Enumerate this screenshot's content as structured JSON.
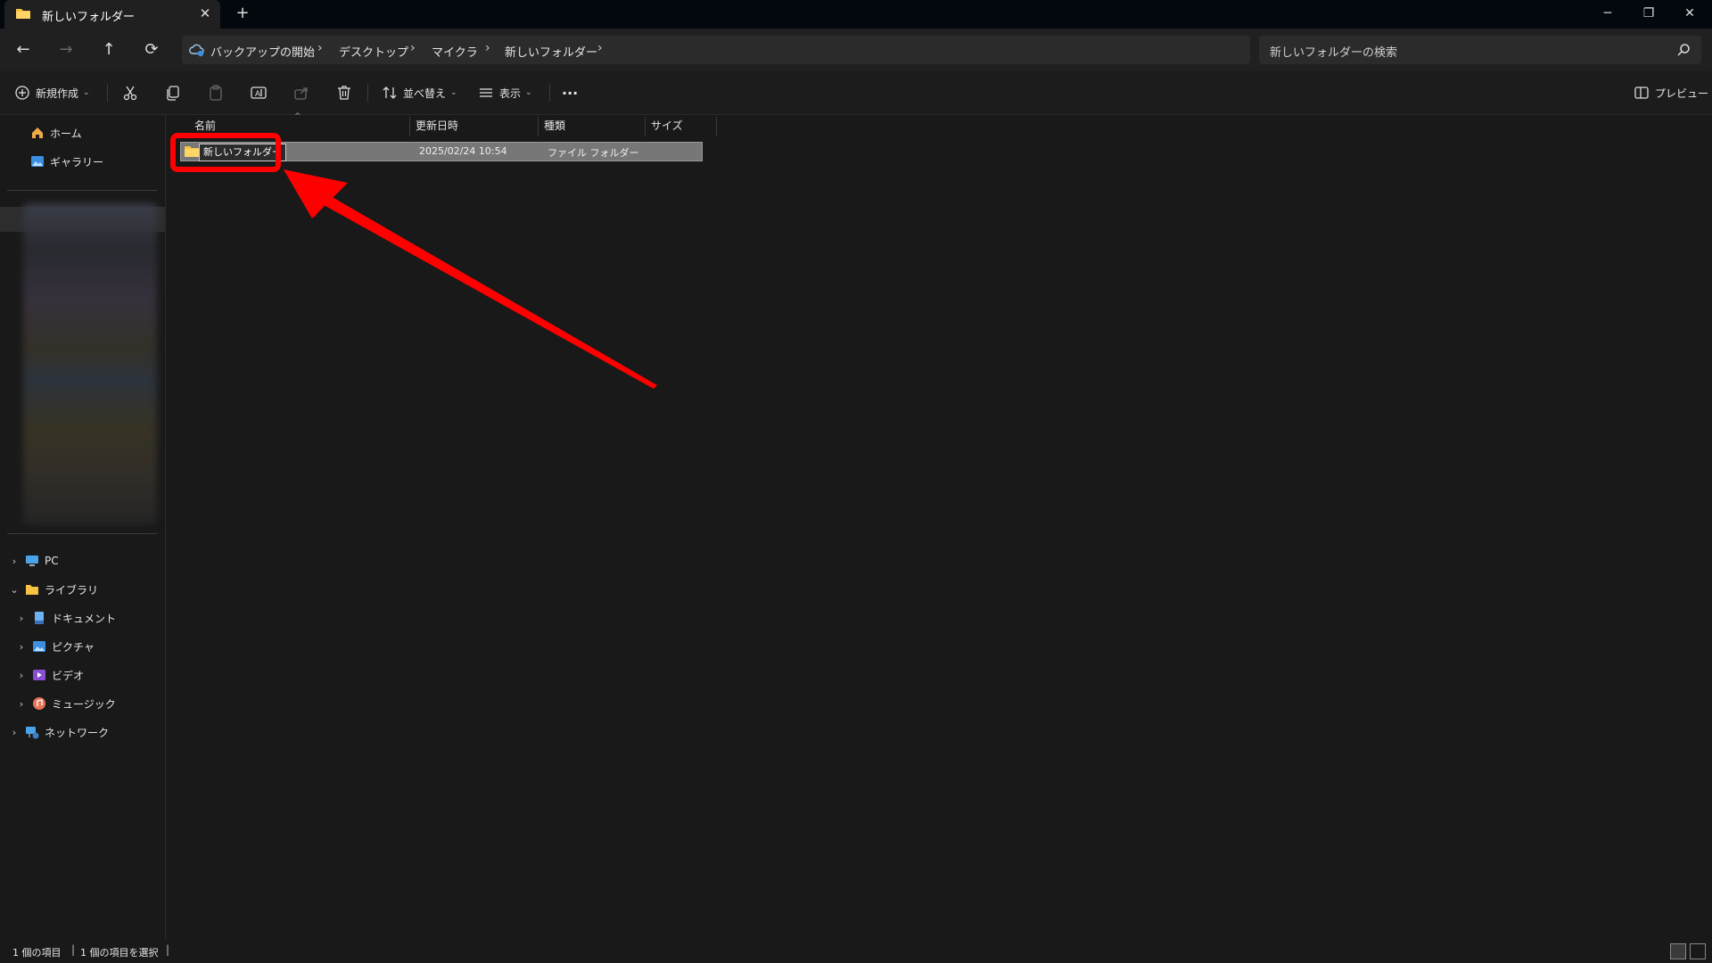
{
  "tab": {
    "title": "新しいフォルダー",
    "close": "✕",
    "new": "+"
  },
  "window": {
    "minimize": "─",
    "restore": "❐",
    "close": "✕"
  },
  "nav": {
    "back": "←",
    "forward": "→",
    "up": "↑",
    "refresh": "⟳"
  },
  "breadcrumb": {
    "items": [
      "バックアップの開始",
      "デスクトップ",
      "マイクラ",
      "新しいフォルダー"
    ],
    "sep": "›"
  },
  "search": {
    "placeholder": "新しいフォルダーの検索"
  },
  "command_bar": {
    "new_label": "新規作成",
    "sort_label": "並べ替え",
    "view_label": "表示",
    "more": "···",
    "preview_label": "プレビュー"
  },
  "sidebar": {
    "quick": [
      {
        "label": "ホーム",
        "icon": "home-icon"
      },
      {
        "label": "ギャラリー",
        "icon": "gallery-icon"
      }
    ],
    "tree": [
      {
        "label": "PC",
        "icon": "pc-icon",
        "expander": "›"
      },
      {
        "label": "ライブラリ",
        "icon": "folder-icon",
        "expander": "⌄"
      },
      {
        "label": "ドキュメント",
        "icon": "document-icon",
        "expander": "›"
      },
      {
        "label": "ピクチャ",
        "icon": "picture-icon",
        "expander": "›"
      },
      {
        "label": "ビデオ",
        "icon": "video-icon",
        "expander": "›"
      },
      {
        "label": "ミュージック",
        "icon": "music-icon",
        "expander": "›"
      },
      {
        "label": "ネットワーク",
        "icon": "network-icon",
        "expander": "›"
      }
    ]
  },
  "columns": {
    "name": "名前",
    "modified": "更新日時",
    "type": "種類",
    "size": "サイズ"
  },
  "files": [
    {
      "name": "新しいフォルダー",
      "modified": "2025/02/24 10:54",
      "type": "ファイル フォルダー",
      "size": ""
    }
  ],
  "status": {
    "count": "1 個の項目",
    "selected": "1 個の項目を選択",
    "sep": "|"
  },
  "colors": {
    "annotation": "#ff0000",
    "folder": "#f5c243",
    "background": "#191919"
  }
}
